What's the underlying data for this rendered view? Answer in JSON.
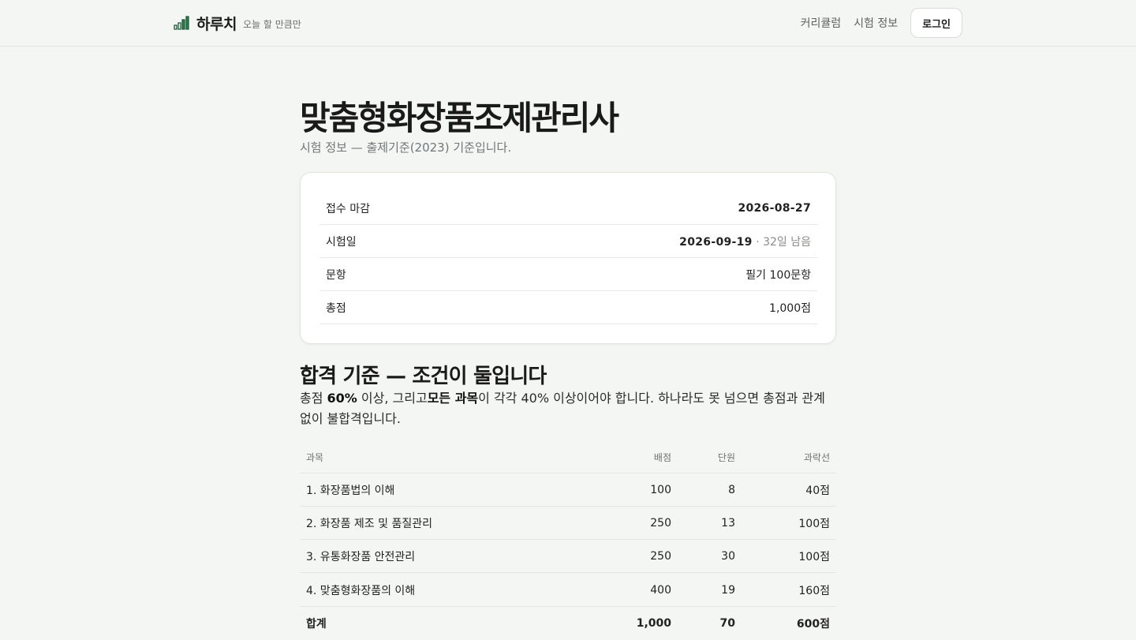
{
  "header": {
    "brand": "하루치",
    "tagline": "오늘 할 만큼만",
    "logo_icon": "signal-bars-icon",
    "accent": "#2e7d4f",
    "nav": [
      {
        "label": "커리큘럼"
      },
      {
        "label": "시험 정보"
      }
    ],
    "login_label": "로그인"
  },
  "page": {
    "title": "맞춤형화장품조제관리사",
    "subtitle": "시험 정보 — 출제기준(2023) 기준입니다."
  },
  "info": {
    "rows": [
      {
        "label": "접수 마감",
        "value": "2026-08-27"
      },
      {
        "label": "시험일",
        "value": "2026-09-19",
        "extra": " · 32일 남음"
      },
      {
        "label": "문항",
        "value": "필기 100문항"
      },
      {
        "label": "총점",
        "value": "1,000점"
      }
    ]
  },
  "pass": {
    "title": "합격 기준 — 조건이 둘입니다",
    "desc_1": "총점 ",
    "desc_2": "60%",
    "desc_3": " 이상, 그리고",
    "desc_4": "모든 과목",
    "desc_5": "이 각각 40% 이상이어야 합니다. 하나라도 못 넘으면 총점과 관계없이 불합격입니다."
  },
  "table": {
    "headers": {
      "subject": "과목",
      "points": "배점",
      "units": "단원",
      "cutoff": "과락선"
    },
    "rows": [
      {
        "subject": "1. 화장품법의 이해",
        "points": "100",
        "units": "8",
        "cutoff": "40점"
      },
      {
        "subject": "2. 화장품 제조 및 품질관리",
        "points": "250",
        "units": "13",
        "cutoff": "100점"
      },
      {
        "subject": "3. 유통화장품 안전관리",
        "points": "250",
        "units": "30",
        "cutoff": "100점"
      },
      {
        "subject": "4. 맞춤형화장품의 이해",
        "points": "400",
        "units": "19",
        "cutoff": "160점"
      }
    ],
    "total": {
      "subject": "합계",
      "points": "1,000",
      "units": "70",
      "cutoff": "600점"
    }
  }
}
